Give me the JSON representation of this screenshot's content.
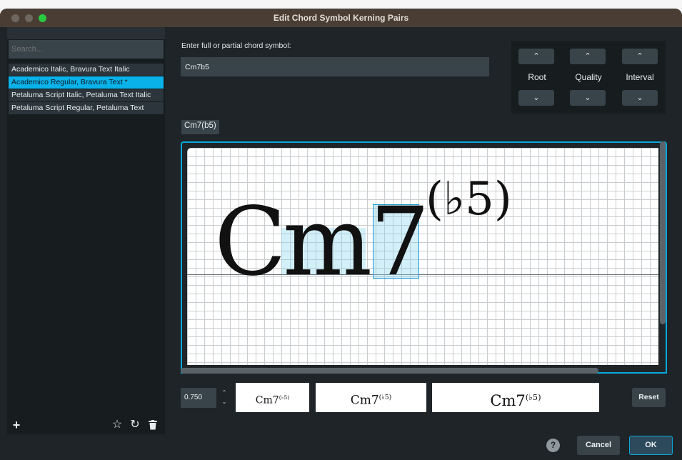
{
  "window": {
    "title": "Edit Chord Symbol Kerning Pairs"
  },
  "sidebar": {
    "search_placeholder": "Search...",
    "items": [
      {
        "label": "Academico Italic, Bravura Text Italic",
        "selected": false
      },
      {
        "label": "Academico Regular, Bravura Text *",
        "selected": true
      },
      {
        "label": "Petaluma Script Italic, Petaluma Text Italic",
        "selected": false
      },
      {
        "label": "Petaluma Script Regular, Petaluma Text",
        "selected": false
      }
    ],
    "buttons": {
      "add": "+",
      "favorite": "☆",
      "revert": "↻",
      "delete_icon": "trash-icon"
    }
  },
  "editor": {
    "prompt": "Enter full or partial chord symbol:",
    "input_value": "Cm7b5",
    "stepper": {
      "up_glyph": "⌃",
      "down_glyph": "⌄",
      "labels": {
        "root": "Root",
        "quality": "Quality",
        "interval": "Interval"
      }
    },
    "preview_tag": "Cm7(b5)",
    "canvas": {
      "root": "C",
      "quality": "m",
      "interval": "7",
      "alteration": "(♭5)"
    },
    "size_value": "0.750",
    "samples": [
      {
        "base": "Cm7",
        "sup": "(♭5)"
      },
      {
        "base": "Cm7",
        "sup": "(♭5)"
      },
      {
        "base": "Cm7",
        "sup": "(♭5)"
      }
    ],
    "reset_label": "Reset"
  },
  "footer": {
    "help": "?",
    "cancel": "Cancel",
    "ok": "OK"
  },
  "colors": {
    "accent": "#0ab2ea",
    "titlebar": "#4a3e34",
    "panel": "#1e2428"
  }
}
